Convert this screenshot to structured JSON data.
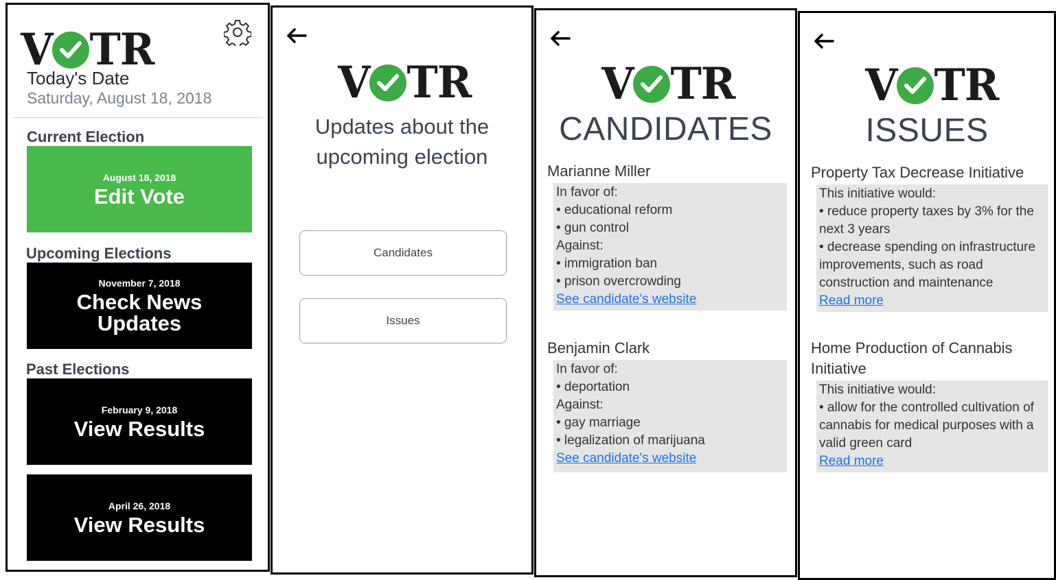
{
  "logo": {
    "left_text": "V",
    "right_text": "TR"
  },
  "colors": {
    "accent_green": "#49b94c",
    "logo_check": "#3cab46",
    "link": "#1a73e8",
    "card_bg": "#e5e5e5"
  },
  "screen1": {
    "today_label": "Today's Date",
    "today_value": "Saturday, August 18, 2018",
    "current_section": "Current Election",
    "current_tile": {
      "date": "August 18, 2018",
      "label": "Edit Vote"
    },
    "upcoming_section": "Upcoming Elections",
    "upcoming_tile": {
      "date": "November 7, 2018",
      "label_line1": "Check News",
      "label_line2": "Updates"
    },
    "past_section": "Past Elections",
    "past_tiles": [
      {
        "date": "February 9, 2018",
        "label": "View Results"
      },
      {
        "date": "April 26, 2018",
        "label": "View Results"
      }
    ],
    "icons": {
      "settings": "gear-icon"
    }
  },
  "screen2": {
    "heading_line1": "Updates about the",
    "heading_line2": "upcoming election",
    "buttons": [
      {
        "label": "Candidates"
      },
      {
        "label": "Issues"
      }
    ],
    "icons": {
      "back": "arrow-left-icon"
    }
  },
  "screen3": {
    "title": "CANDIDATES",
    "candidates": [
      {
        "name": "Marianne Miller",
        "favor_label": "In favor of:",
        "favor": [
          "• educational reform",
          "• gun control"
        ],
        "against_label": "Against:",
        "against": [
          "• immigration ban",
          "• prison overcrowding"
        ],
        "link": "See candidate's website"
      },
      {
        "name": "Benjamin Clark",
        "favor_label": "In favor of:",
        "favor": [
          "• deportation"
        ],
        "against_label": "Against:",
        "against": [
          "• gay marriage",
          "• legalization of marijuana"
        ],
        "link": "See candidate's website"
      }
    ]
  },
  "screen4": {
    "title": "ISSUES",
    "issues": [
      {
        "title": "Property Tax Decrease Initiative",
        "intro": "This initiative would:",
        "points": [
          "• reduce property taxes by 3% for the next 3 years",
          "• decrease spending on infrastructure improvements, such as road construction and maintenance"
        ],
        "link": "Read more"
      },
      {
        "title_line1": "Home Production of Cannabis",
        "title_line2": "Initiative",
        "intro": "This initiative would:",
        "points": [
          "• allow for the controlled cultivation of cannabis for medical purposes with a valid green card"
        ],
        "link": "Read more"
      }
    ]
  }
}
